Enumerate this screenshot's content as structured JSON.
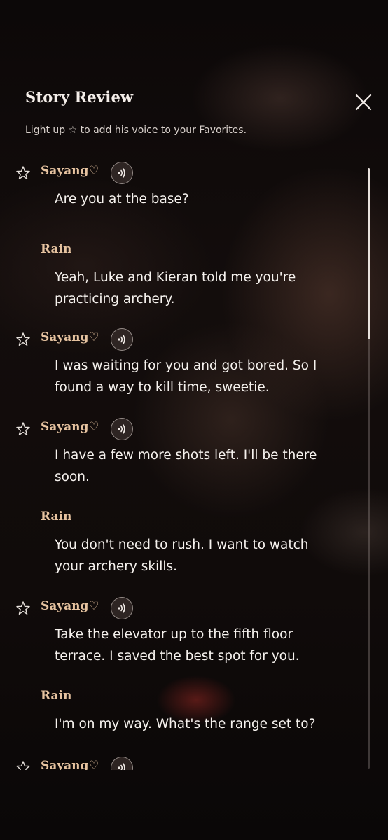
{
  "header": {
    "title": "Story Review",
    "hint": "Light up ☆ to add his voice to your Favorites."
  },
  "dialogue": [
    {
      "speaker": "Sayang♡",
      "has_star": true,
      "has_voice": true,
      "lines": [
        "Are you at the base?"
      ]
    },
    {
      "speaker": "Rain",
      "has_star": false,
      "has_voice": false,
      "lines": [
        "Yeah, Luke and Kieran told me you're",
        "practicing archery."
      ]
    },
    {
      "speaker": "Sayang♡",
      "has_star": true,
      "has_voice": true,
      "lines": [
        "I was waiting for you and got bored. So I",
        "found a way to kill time, sweetie."
      ]
    },
    {
      "speaker": "Sayang♡",
      "has_star": true,
      "has_voice": true,
      "lines": [
        "I have a few more shots left. I'll be there",
        "soon."
      ]
    },
    {
      "speaker": "Rain",
      "has_star": false,
      "has_voice": false,
      "lines": [
        "You don't need to rush. I want to watch",
        "your archery skills."
      ]
    },
    {
      "speaker": "Sayang♡",
      "has_star": true,
      "has_voice": true,
      "lines": [
        "Take the elevator up to the fifth floor",
        "terrace. I saved the best spot for you."
      ]
    },
    {
      "speaker": "Rain",
      "has_star": false,
      "has_voice": false,
      "lines": [
        "I'm on my way. What's the range set to?"
      ]
    },
    {
      "speaker": "Sayang♡",
      "has_star": true,
      "has_voice": true,
      "lines": []
    }
  ],
  "icons": {
    "close": "close-icon",
    "star": "star-outline-icon",
    "voice": "voice-play-icon"
  },
  "colors": {
    "speaker": "#e6c3a0",
    "text": "#f6f2ee",
    "background": "#0d0908"
  }
}
